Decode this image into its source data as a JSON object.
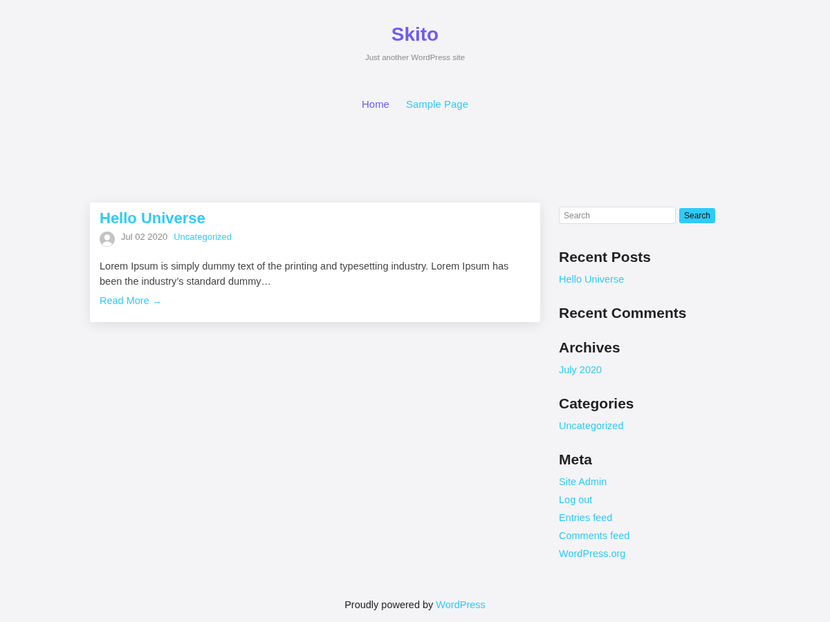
{
  "site": {
    "title": "Skito",
    "tagline": "Just another WordPress site"
  },
  "nav": [
    {
      "label": "Home",
      "selected": true
    },
    {
      "label": "Sample Page",
      "selected": false
    }
  ],
  "posts": [
    {
      "title": "Hello Universe",
      "date": "Jul 02 2020",
      "category": "Uncategorized",
      "excerpt": "Lorem Ipsum is simply dummy text of the printing and typesetting industry. Lorem Ipsum has been the industry’s standard dummy…",
      "read_more": "Read More →"
    }
  ],
  "sidebar": {
    "search": {
      "placeholder": "Search",
      "button": "Search"
    },
    "widgets": [
      {
        "title": "Recent Posts",
        "links": [
          "Hello Universe"
        ]
      },
      {
        "title": "Recent Comments"
      },
      {
        "title": "Archives",
        "links": [
          "July 2020"
        ]
      },
      {
        "title": "Categories",
        "links": [
          "Uncategorized"
        ]
      },
      {
        "title": "Meta",
        "links": [
          "Site Admin",
          "Log out",
          "Entries feed",
          "Comments feed",
          "WordPress.org"
        ]
      }
    ]
  },
  "footer": {
    "text": "Proudly powered by",
    "link": "WordPress"
  }
}
